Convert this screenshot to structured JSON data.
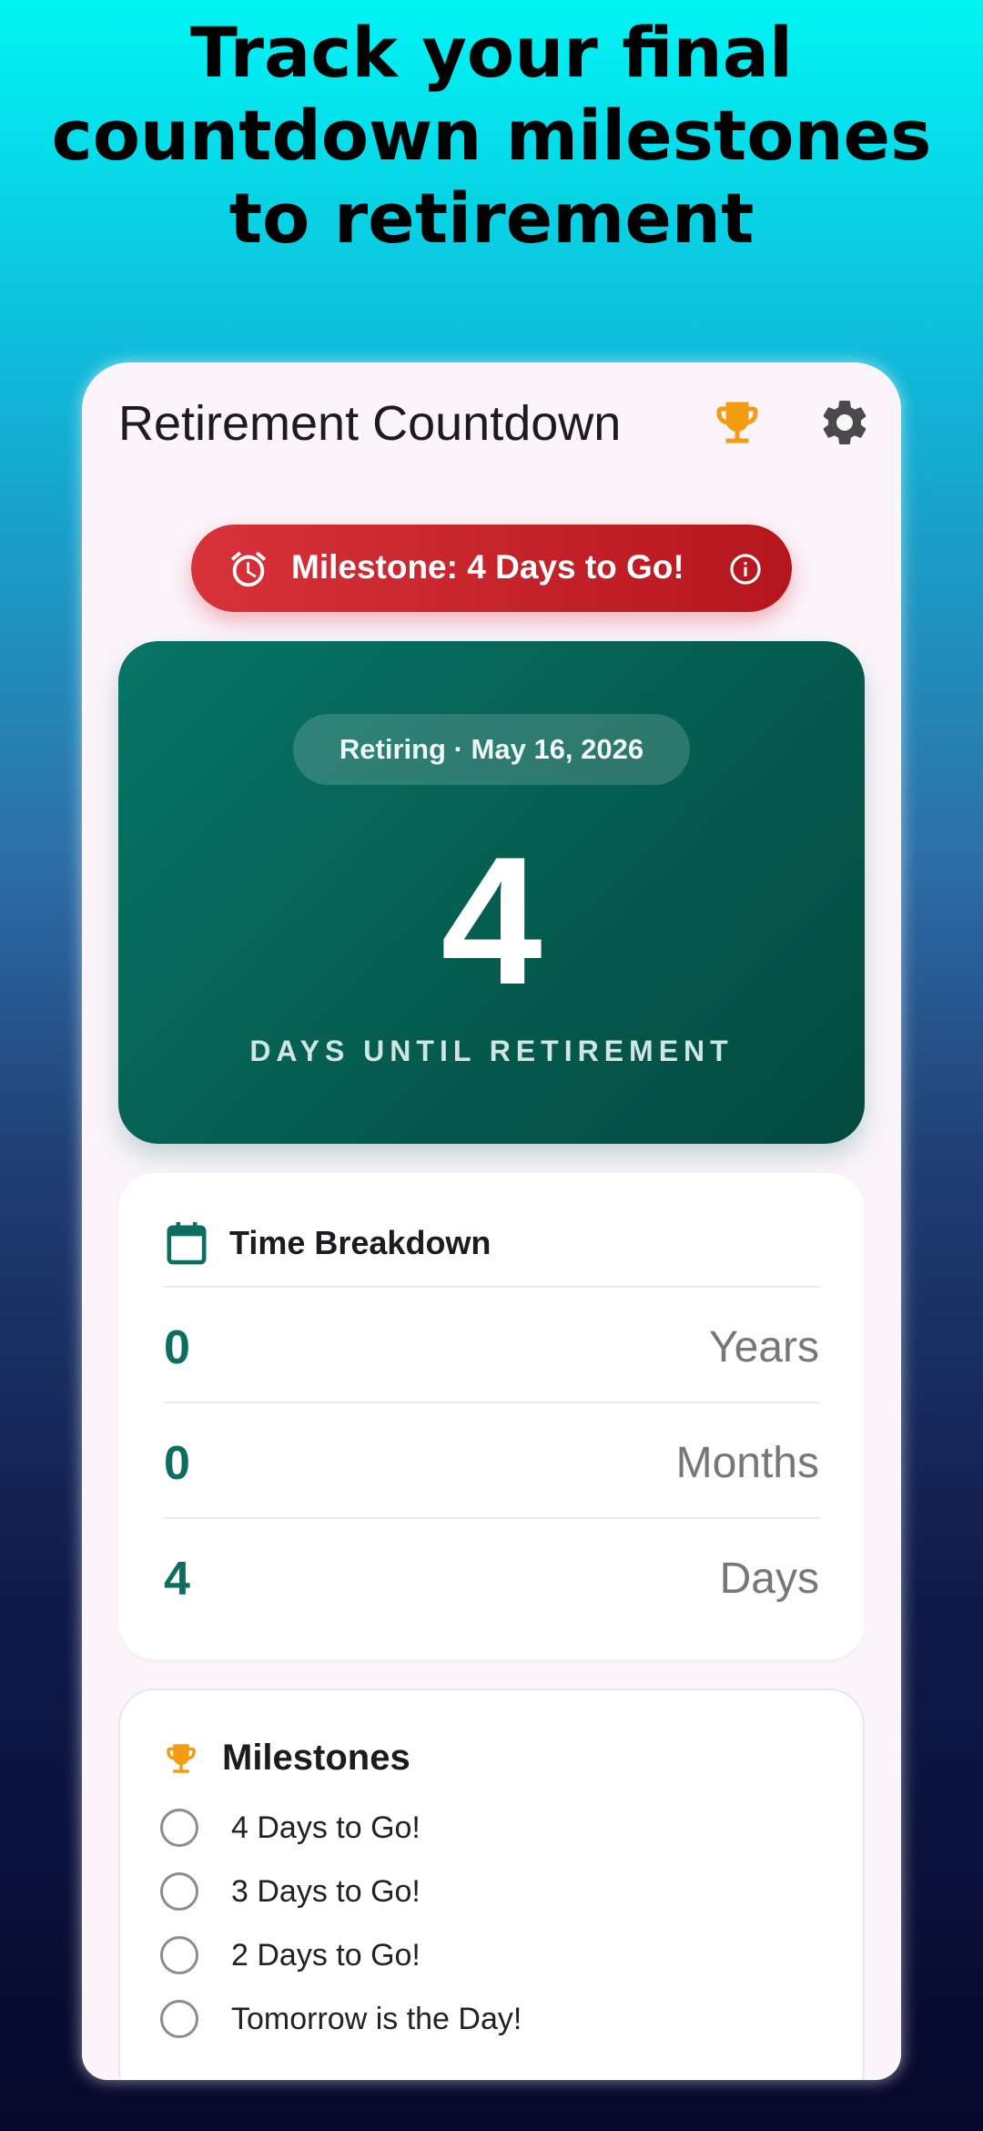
{
  "headline": "Track your final countdown milestones to retirement",
  "app": {
    "title": "Retirement Countdown",
    "icons": {
      "trophy": "trophy-icon",
      "settings": "gear-icon"
    }
  },
  "banner": {
    "text": "Milestone: 4 Days to Go!",
    "icons": {
      "left": "alarm-icon",
      "right": "info-icon"
    },
    "color": "#d32f2f"
  },
  "hero": {
    "retiring_label": "Retiring · May 16, 2026",
    "days": "4",
    "caption": "DAYS UNTIL RETIREMENT",
    "color": "#00695c"
  },
  "breakdown": {
    "title": "Time Breakdown",
    "icon": "calendar-icon",
    "rows": [
      {
        "value": "0",
        "unit": "Years"
      },
      {
        "value": "0",
        "unit": "Months"
      },
      {
        "value": "4",
        "unit": "Days"
      }
    ]
  },
  "milestones": {
    "title": "Milestones",
    "icon": "trophy-icon",
    "items": [
      {
        "label": "4 Days to Go!",
        "checked": false
      },
      {
        "label": "3 Days to Go!",
        "checked": false
      },
      {
        "label": "2 Days to Go!",
        "checked": false
      },
      {
        "label": "Tomorrow is the Day!",
        "checked": false
      }
    ]
  },
  "colors": {
    "accent": "#0b6e61",
    "trophy": "#f39c12"
  }
}
